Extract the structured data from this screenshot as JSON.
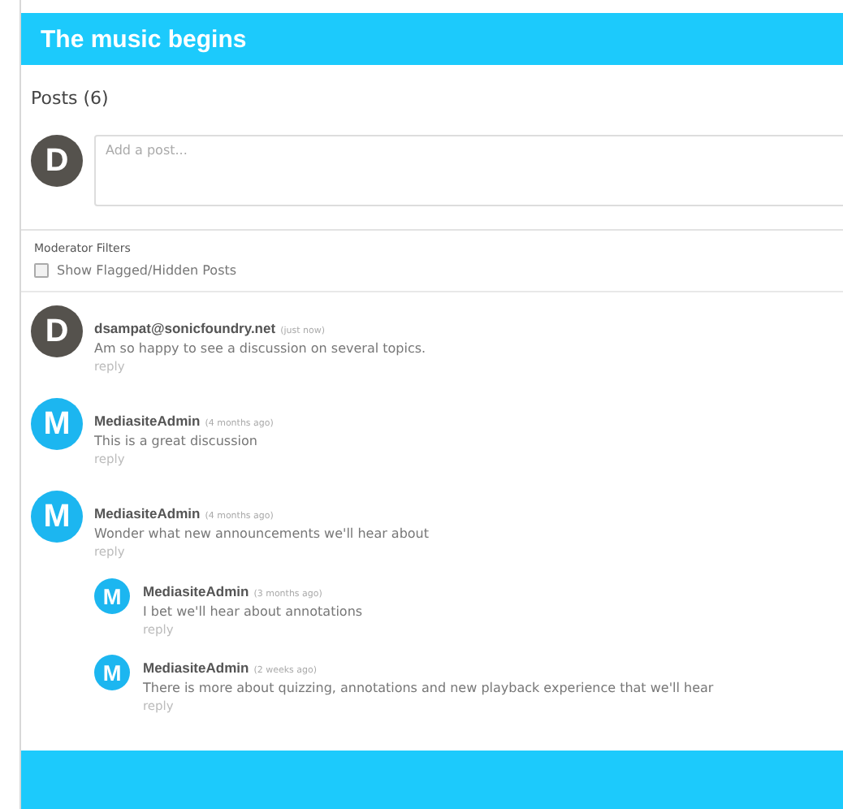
{
  "header": {
    "title": "The music begins"
  },
  "posts_heading": "Posts (6)",
  "composer": {
    "avatar_letter": "D",
    "color": "#55524d",
    "placeholder": "Add a post..."
  },
  "moderator_filters": {
    "title": "Moderator Filters",
    "options": [
      {
        "label": "Show Flagged/Hidden Posts",
        "checked": false
      }
    ]
  },
  "posts": [
    {
      "avatar_letter": "D",
      "color": "#55524d",
      "author": "dsampat@sonicfoundry.net",
      "time": "(just now)",
      "text": "Am so happy to see a discussion on several topics.",
      "reply": "reply"
    },
    {
      "avatar_letter": "M",
      "color": "#1cb6f0",
      "author": "MediasiteAdmin",
      "time": "(4 months ago)",
      "text": "This is a great discussion",
      "reply": "reply"
    },
    {
      "avatar_letter": "M",
      "color": "#1cb6f0",
      "author": "MediasiteAdmin",
      "time": "(4 months ago)",
      "text": "Wonder what new announcements we'll hear about",
      "reply": "reply",
      "children": [
        {
          "avatar_letter": "M",
          "color": "#1cb6f0",
          "author": "MediasiteAdmin",
          "time": "(3 months ago)",
          "text": "I bet we'll hear about annotations",
          "reply": "reply"
        },
        {
          "avatar_letter": "M",
          "color": "#1cb6f0",
          "author": "MediasiteAdmin",
          "time": "(2 weeks ago)",
          "text": "There is more about quizzing, annotations and new playback experience that we'll hear",
          "reply": "reply"
        }
      ]
    }
  ]
}
